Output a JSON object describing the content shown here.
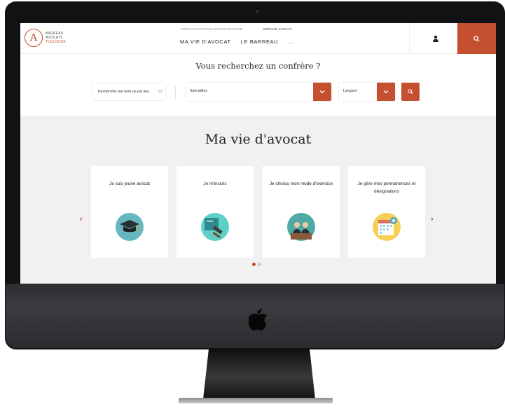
{
  "header": {
    "logo_lines": [
      "BARREAU",
      "AVOCATS",
      "TOULOUSE"
    ],
    "top_links": [
      "ESPACE PARTICULIER/ENTREPRISE",
      "ESPACE AVOCAT"
    ],
    "nav": [
      "MA VIE D'AVOCAT",
      "LE BARREAU",
      "..."
    ]
  },
  "finder": {
    "title": "Vous recherchez un confrère ?",
    "name_placeholder": "Rechercher par nom ou par lieu",
    "specialites_label": "Spécialités",
    "langues_label": "Langues"
  },
  "section": {
    "title": "Ma vie d'avocat",
    "cards": [
      {
        "label": "Je suis jeune avocat",
        "icon": "graduation-cap-icon"
      },
      {
        "label": "Je m'inscris",
        "icon": "gavel-book-icon"
      },
      {
        "label": "Je choisis mon mode d'exercice",
        "icon": "lawyers-icon"
      },
      {
        "label": "Je gère mes permanences et désignations",
        "icon": "calendar-gear-icon"
      }
    ],
    "prev_arrow": "‹",
    "next_arrow": "›"
  },
  "colors": {
    "accent": "#c4502f",
    "section_bg": "#f1f1f1"
  }
}
